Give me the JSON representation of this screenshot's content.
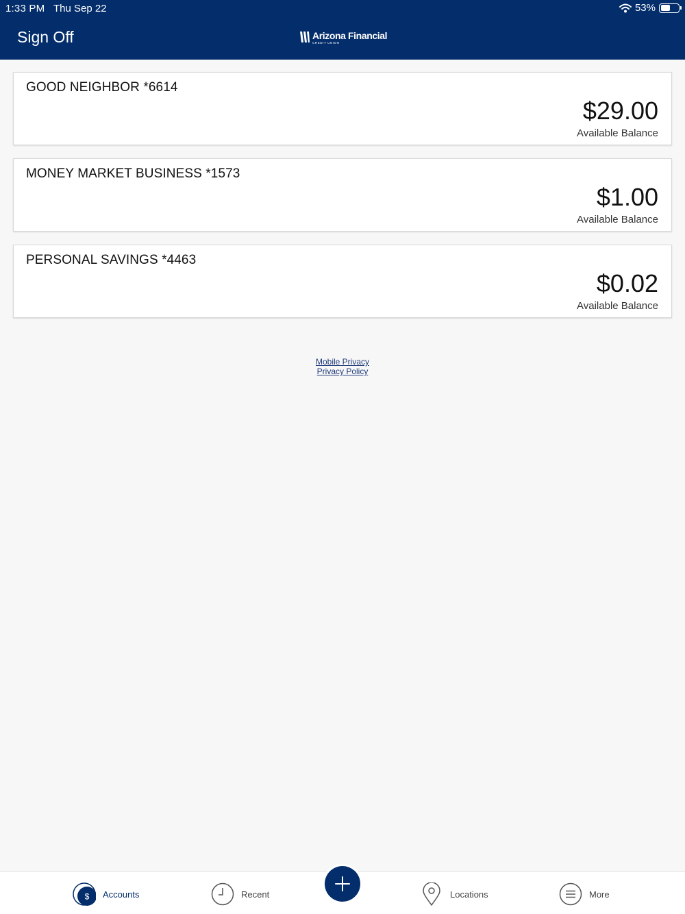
{
  "status_bar": {
    "time": "1:33 PM",
    "date": "Thu Sep 22",
    "battery": "53%",
    "battery_level": 0.53
  },
  "header": {
    "sign_off_label": "Sign Off",
    "brand_name": "Arizona Financial",
    "brand_sub": "CREDIT UNION",
    "background_color": "#032d6b"
  },
  "accounts": [
    {
      "name": "GOOD NEIGHBOR *6614",
      "balance": "$29.00",
      "balance_label": "Available Balance"
    },
    {
      "name": "MONEY MARKET BUSINESS *1573",
      "balance": "$1.00",
      "balance_label": "Available Balance"
    },
    {
      "name": "PERSONAL SAVINGS *4463",
      "balance": "$0.02",
      "balance_label": "Available Balance"
    }
  ],
  "links": {
    "mobile_privacy": "Mobile Privacy",
    "privacy_policy": "Privacy Policy"
  },
  "tabbar": {
    "accounts": {
      "label": "Accounts",
      "icon": "dollar-icon"
    },
    "recent": {
      "label": "Recent",
      "icon": "clock-icon"
    },
    "add": {
      "icon": "plus-icon"
    },
    "locations": {
      "label": "Locations",
      "icon": "location-pin-icon"
    },
    "more": {
      "label": "More",
      "icon": "menu-icon"
    }
  }
}
